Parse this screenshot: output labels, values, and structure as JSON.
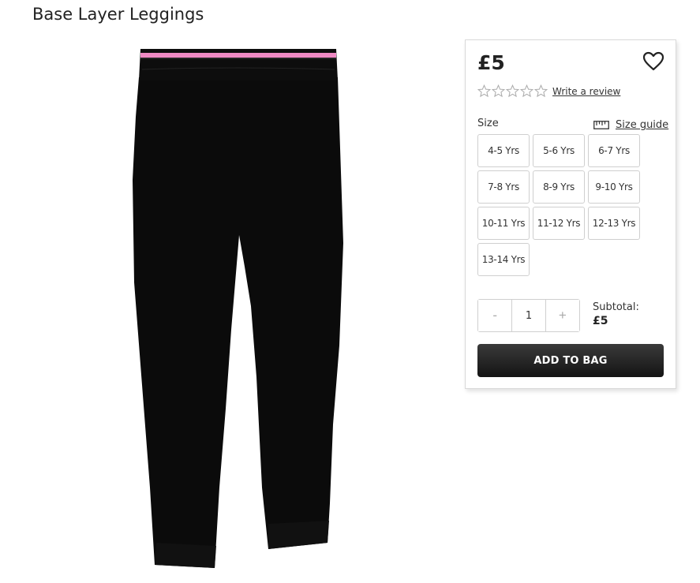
{
  "product": {
    "title": "Base Layer Leggings",
    "image_alt": "black leggings with pink waistband stripe"
  },
  "purchase": {
    "price": "£5",
    "wishlist_icon": "heart-icon",
    "rating": {
      "value": 0,
      "max": 5,
      "star_icon": "star-outline-icon"
    },
    "review_link": "Write a review",
    "size_label": "Size",
    "size_guide": {
      "label": "Size guide",
      "icon": "ruler-icon"
    },
    "sizes": [
      "4-5 Yrs",
      "5-6 Yrs",
      "6-7 Yrs",
      "7-8 Yrs",
      "8-9 Yrs",
      "9-10 Yrs",
      "10-11 Yrs",
      "11-12 Yrs",
      "12-13 Yrs",
      "13-14 Yrs"
    ],
    "quantity": {
      "decrement": "-",
      "value": "1",
      "increment": "+"
    },
    "subtotal": {
      "label": "Subtotal:",
      "value": "£5"
    },
    "add_to_bag": "ADD TO BAG"
  },
  "colors": {
    "button_dark": "#1f1f1f",
    "waistband_pink": "#f08ac4",
    "garment_black": "#0b0b0b"
  }
}
